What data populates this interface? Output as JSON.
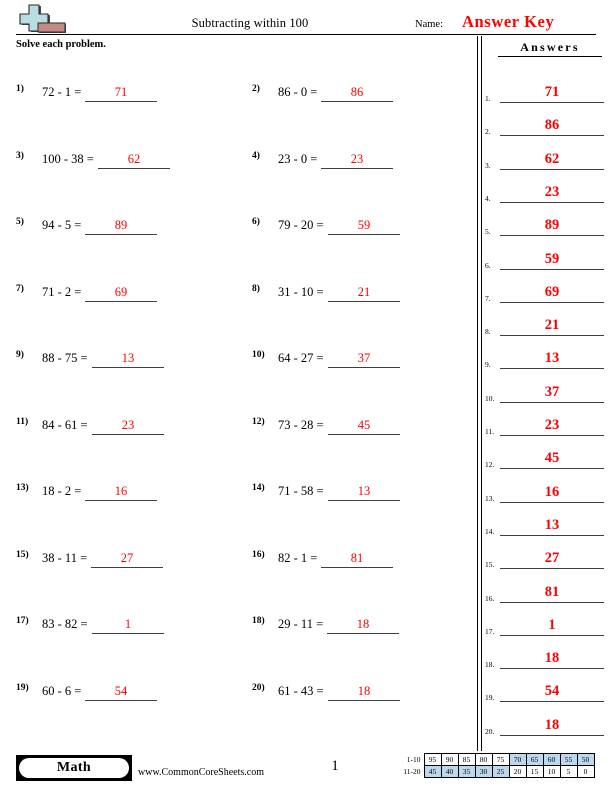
{
  "header": {
    "logo_icon": "plus-minus-logo",
    "title": "Subtracting within 100",
    "name_label": "Name:",
    "answer_key_text": "Answer Key",
    "instructions": "Solve each problem."
  },
  "answers_panel": {
    "title": "Answers"
  },
  "problems": [
    {
      "num": "1)",
      "expr": "72 - 1 =",
      "answer": "71"
    },
    {
      "num": "2)",
      "expr": "86 - 0 =",
      "answer": "86"
    },
    {
      "num": "3)",
      "expr": "100 - 38 =",
      "answer": "62"
    },
    {
      "num": "4)",
      "expr": "23 - 0 =",
      "answer": "23"
    },
    {
      "num": "5)",
      "expr": "94 - 5 =",
      "answer": "89"
    },
    {
      "num": "6)",
      "expr": "79 - 20 =",
      "answer": "59"
    },
    {
      "num": "7)",
      "expr": "71 - 2 =",
      "answer": "69"
    },
    {
      "num": "8)",
      "expr": "31 - 10 =",
      "answer": "21"
    },
    {
      "num": "9)",
      "expr": "88 - 75 =",
      "answer": "13"
    },
    {
      "num": "10)",
      "expr": "64 - 27 =",
      "answer": "37"
    },
    {
      "num": "11)",
      "expr": "84 - 61 =",
      "answer": "23"
    },
    {
      "num": "12)",
      "expr": "73 - 28 =",
      "answer": "45"
    },
    {
      "num": "13)",
      "expr": "18 - 2 =",
      "answer": "16"
    },
    {
      "num": "14)",
      "expr": "71 - 58 =",
      "answer": "13"
    },
    {
      "num": "15)",
      "expr": "38 - 11 =",
      "answer": "27"
    },
    {
      "num": "16)",
      "expr": "82 - 1 =",
      "answer": "81"
    },
    {
      "num": "17)",
      "expr": "83 - 82 =",
      "answer": "1"
    },
    {
      "num": "18)",
      "expr": "29 - 11 =",
      "answer": "18"
    },
    {
      "num": "19)",
      "expr": "60 - 6 =",
      "answer": "54"
    },
    {
      "num": "20)",
      "expr": "61 - 43 =",
      "answer": "18"
    }
  ],
  "answer_list": [
    {
      "num": "1.",
      "value": "71"
    },
    {
      "num": "2.",
      "value": "86"
    },
    {
      "num": "3.",
      "value": "62"
    },
    {
      "num": "4.",
      "value": "23"
    },
    {
      "num": "5.",
      "value": "89"
    },
    {
      "num": "6.",
      "value": "59"
    },
    {
      "num": "7.",
      "value": "69"
    },
    {
      "num": "8.",
      "value": "21"
    },
    {
      "num": "9.",
      "value": "13"
    },
    {
      "num": "10.",
      "value": "37"
    },
    {
      "num": "11.",
      "value": "23"
    },
    {
      "num": "12.",
      "value": "45"
    },
    {
      "num": "13.",
      "value": "16"
    },
    {
      "num": "14.",
      "value": "13"
    },
    {
      "num": "15.",
      "value": "27"
    },
    {
      "num": "16.",
      "value": "81"
    },
    {
      "num": "17.",
      "value": "1"
    },
    {
      "num": "18.",
      "value": "18"
    },
    {
      "num": "19.",
      "value": "54"
    },
    {
      "num": "20.",
      "value": "18"
    }
  ],
  "footer": {
    "subject_badge": "Math",
    "website": "www.CommonCoreSheets.com",
    "page_number": "1"
  },
  "score_table": {
    "row_labels": [
      "1-10",
      "11-20"
    ],
    "rows": [
      [
        {
          "v": "95",
          "hl": false
        },
        {
          "v": "90",
          "hl": false
        },
        {
          "v": "85",
          "hl": false
        },
        {
          "v": "80",
          "hl": false
        },
        {
          "v": "75",
          "hl": false
        },
        {
          "v": "70",
          "hl": true
        },
        {
          "v": "65",
          "hl": true
        },
        {
          "v": "60",
          "hl": true
        },
        {
          "v": "55",
          "hl": true
        },
        {
          "v": "50",
          "hl": true
        }
      ],
      [
        {
          "v": "45",
          "hl": true
        },
        {
          "v": "40",
          "hl": true
        },
        {
          "v": "35",
          "hl": true
        },
        {
          "v": "30",
          "hl": true
        },
        {
          "v": "25",
          "hl": true
        },
        {
          "v": "20",
          "hl": false
        },
        {
          "v": "15",
          "hl": false
        },
        {
          "v": "10",
          "hl": false
        },
        {
          "v": "5",
          "hl": false
        },
        {
          "v": "0",
          "hl": false
        }
      ]
    ],
    "highlight_color": "#bdd7ee"
  },
  "colors": {
    "answer_red": "#ff0000",
    "rule_black": "#000000",
    "blank_line": "#3f3f3f"
  }
}
